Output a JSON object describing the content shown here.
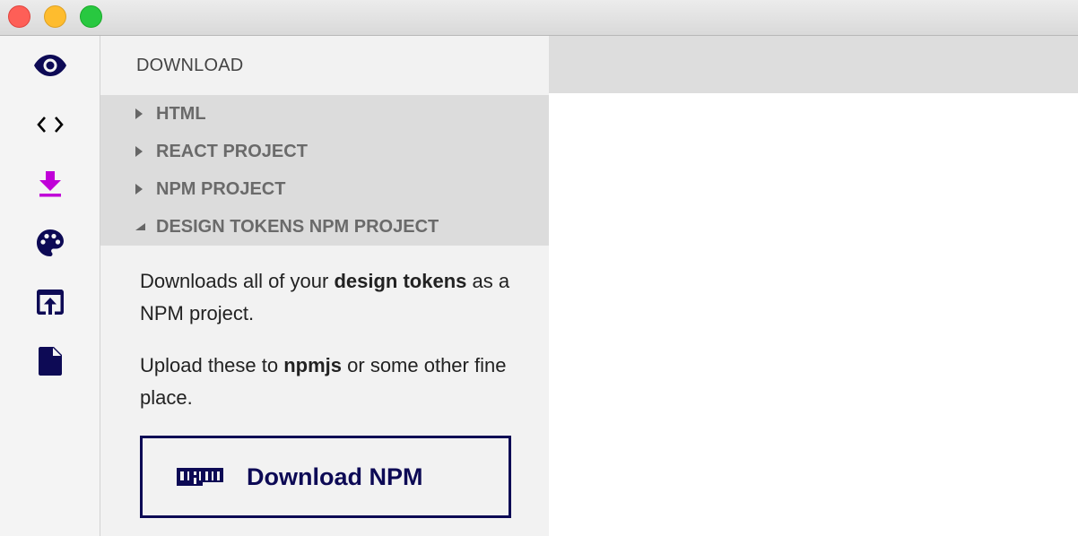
{
  "window": {
    "controls": [
      "close",
      "minimize",
      "maximize"
    ]
  },
  "sidebar": {
    "icons": [
      {
        "name": "eye-icon",
        "color": "#0d0a55"
      },
      {
        "name": "code-icon",
        "color": "#000000"
      },
      {
        "name": "download-icon",
        "color": "#c000d8",
        "active": true
      },
      {
        "name": "palette-icon",
        "color": "#0d0a55"
      },
      {
        "name": "open-in-browser-icon",
        "color": "#0d0a55"
      },
      {
        "name": "document-icon",
        "color": "#0d0a55"
      }
    ]
  },
  "panel": {
    "title": "DOWNLOAD",
    "accordion": [
      {
        "label": "HTML",
        "expanded": false
      },
      {
        "label": "REACT PROJECT",
        "expanded": false
      },
      {
        "label": "NPM PROJECT",
        "expanded": false
      },
      {
        "label": "DESIGN TOKENS NPM PROJECT",
        "expanded": true
      }
    ],
    "content": {
      "p1_prefix": "Downloads all of your ",
      "p1_bold": "design tokens",
      "p1_suffix": " as a NPM project.",
      "p2_prefix": "Upload these to ",
      "p2_bold": "npmjs",
      "p2_suffix": " or some other fine place."
    },
    "button": {
      "icon": "npm-logo-icon",
      "label": "Download NPM"
    }
  },
  "colors": {
    "accent": "#0d0a55",
    "active_icon": "#c000d8"
  }
}
